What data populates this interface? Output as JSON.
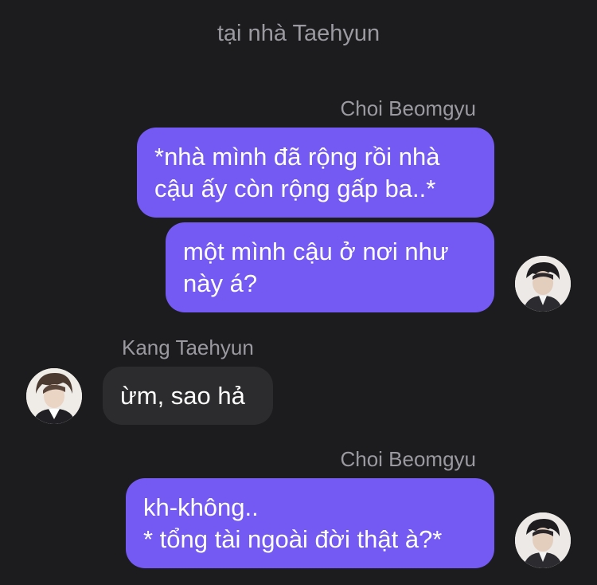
{
  "conversation": {
    "title": "tại nhà Taehyun"
  },
  "messages": [
    {
      "sender": "Choi Beomgyu",
      "text": "*nhà mình đã rộng rồi nhà\ncậu ấy còn rộng gấp ba..*"
    },
    {
      "sender": "Choi Beomgyu",
      "text": "một mình cậu ở nơi như\nnày á?"
    },
    {
      "sender": "Kang Taehyun",
      "text": "ừm, sao hả"
    },
    {
      "sender": "Choi Beomgyu",
      "text": "kh-không..\n* tổng tài ngoài đời thật à?*"
    }
  ],
  "colors": {
    "background": "#1c1c1e",
    "outgoing_bubble": "#7459f2",
    "incoming_bubble": "#2c2c2e",
    "secondary_text": "#9a9aa0"
  },
  "icons": {
    "beomgyu_avatar": "avatar-photo",
    "taehyun_avatar": "avatar-photo"
  }
}
